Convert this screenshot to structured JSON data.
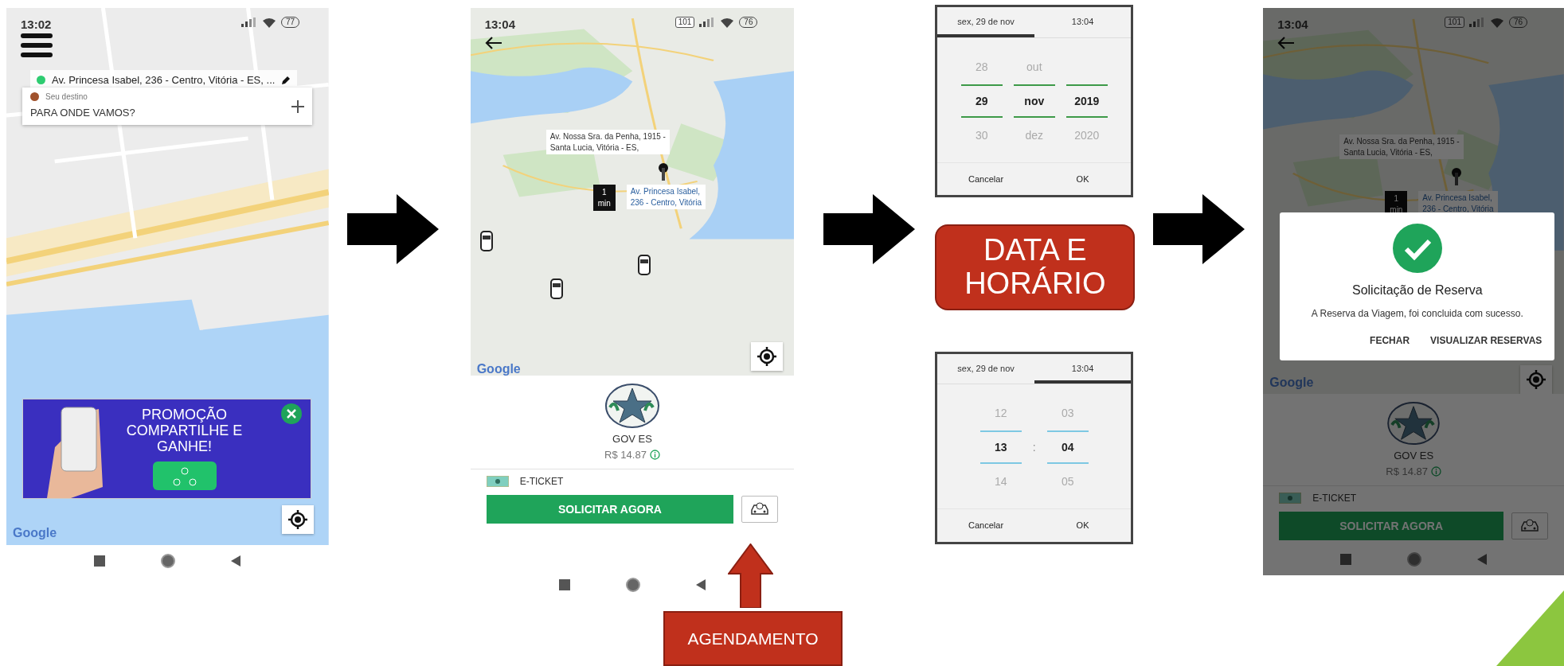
{
  "home_screen": {
    "status": {
      "time": "13:02",
      "battery": "77"
    },
    "origin": {
      "text": "Av. Princesa Isabel, 236 - Centro, Vitória - ES, ...",
      "color": "#2ecc71"
    },
    "destination": {
      "label": "Seu destino",
      "placeholder": "PARA ONDE VAMOS?",
      "color": "#a0522d"
    },
    "promo": {
      "text": "PROMOÇÃO COMPARTILHE E GANHE!"
    },
    "map_logo": "Google"
  },
  "request_screen": {
    "status": {
      "time": "13:04",
      "battery": "76",
      "badge": "101"
    },
    "callouts": [
      {
        "text": "Av. Nossa Sra. da Penha, 1915 -\nSanta Lucia, Vitória - ES,"
      },
      {
        "eta": "1\nmin",
        "text": "Av. Princesa Isabel,\n236 - Centro, Vitória"
      }
    ],
    "map_logo": "Google",
    "service": {
      "name": "GOV ES",
      "price": "R$ 14.87"
    },
    "payment": "E-TICKET",
    "primary_button": "SOLICITAR AGORA"
  },
  "schedule_annotation": {
    "text": "AGENDAMENTO"
  },
  "pickers": [
    {
      "kind": "date",
      "tabs": [
        {
          "label": "sex, 29 de nov",
          "selected": true
        },
        {
          "label": "13:04",
          "selected": false
        }
      ],
      "columns": [
        {
          "above": "28",
          "value": "29",
          "below": "30"
        },
        {
          "above": "out",
          "value": "nov",
          "below": "dez"
        },
        {
          "value": "2019",
          "below": "2020"
        }
      ],
      "buttons": [
        "Cancelar",
        "OK"
      ]
    },
    {
      "kind": "time",
      "tabs": [
        {
          "label": "sex, 29 de nov",
          "selected": false
        },
        {
          "label": "13:04",
          "selected": true
        }
      ],
      "separator": ":",
      "columns": [
        {
          "above": "12",
          "value": "13",
          "below": "14"
        },
        {
          "above": "03",
          "value": "04",
          "below": "05"
        }
      ],
      "buttons": [
        "Cancelar",
        "OK"
      ]
    }
  ],
  "picker_annotation": {
    "text": "DATA E HORÁRIO"
  },
  "confirmation_screen": {
    "status": {
      "time": "13:04",
      "battery": "76",
      "badge": "101"
    },
    "callouts": [
      {
        "text": "Av. Nossa Sra. da Penha, 1915 -\nSanta Lucia, Vitória - ES,"
      },
      {
        "eta": "1\nmin",
        "text": "Av. Princesa Isabel,\n236 - Centro, Vitória"
      }
    ],
    "map_logo": "Google",
    "service": {
      "name": "GOV ES",
      "price": "R$ 14.87"
    },
    "payment": "E-TICKET",
    "primary_button": "SOLICITAR AGORA",
    "dialog": {
      "title": "Solicitação de Reserva",
      "message": "A Reserva da Viagem, foi concluida com sucesso.",
      "buttons": [
        "FECHAR",
        "VISUALIZAR RESERVAS"
      ]
    }
  }
}
